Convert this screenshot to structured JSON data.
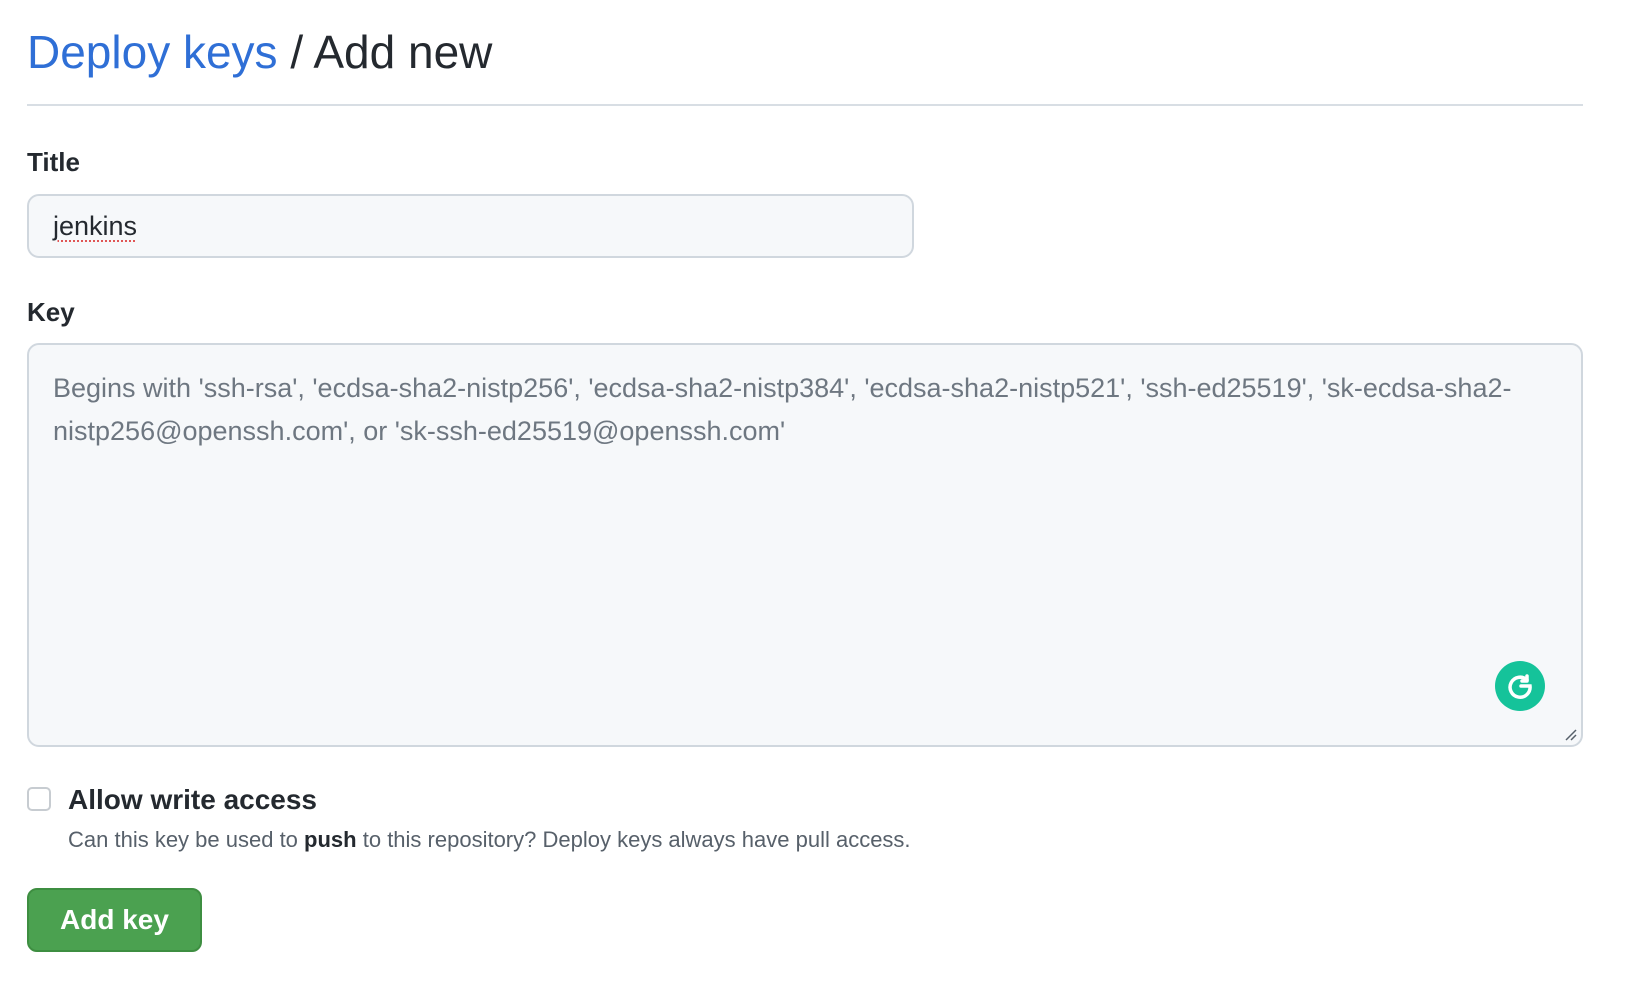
{
  "header": {
    "breadcrumb_link": "Deploy keys",
    "separator": "/",
    "current": "Add new"
  },
  "form": {
    "title_label": "Title",
    "title_value": "jenkins",
    "key_label": "Key",
    "key_placeholder": "Begins with 'ssh-rsa', 'ecdsa-sha2-nistp256', 'ecdsa-sha2-nistp384', 'ecdsa-sha2-nistp521', 'ssh-ed25519', 'sk-ecdsa-sha2-nistp256@openssh.com', or 'sk-ssh-ed25519@openssh.com'",
    "write_access_label": "Allow write access",
    "write_access_checked": false,
    "write_access_help_prefix": "Can this key be used to",
    "write_access_help_bold": "push",
    "write_access_help_suffix": "to this repository? Deploy keys always have pull access.",
    "submit_label": "Add key"
  },
  "colors": {
    "link": "#2f6fd6",
    "button_bg": "#4ba150",
    "grammarly": "#15c39a",
    "input_bg": "#f6f8fa"
  },
  "icons": {
    "grammarly": "grammarly-icon",
    "resize": "resize-handle-icon"
  }
}
